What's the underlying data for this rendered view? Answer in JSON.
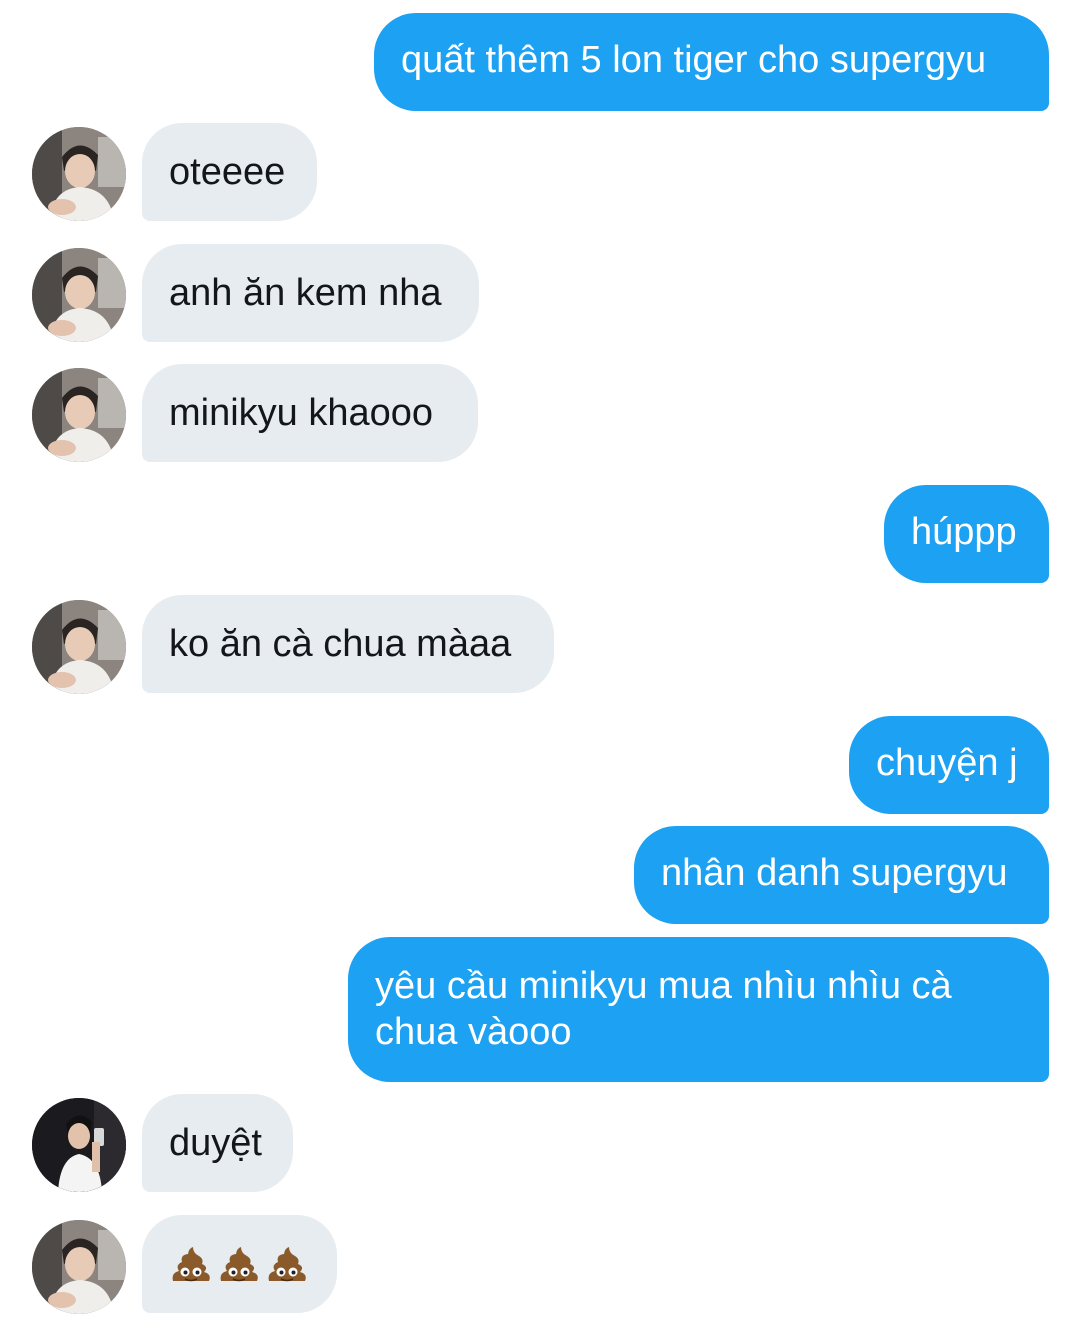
{
  "messages": [
    {
      "id": "m1",
      "side": "out",
      "text": "quất thêm 5 lon tiger cho supergyu"
    },
    {
      "id": "m2",
      "side": "in",
      "avatar": "user-a",
      "text": "oteeee"
    },
    {
      "id": "m3",
      "side": "in",
      "avatar": "user-a",
      "text": "anh ăn kem nha"
    },
    {
      "id": "m4",
      "side": "in",
      "avatar": "user-a",
      "text": "minikyu khaooo"
    },
    {
      "id": "m5",
      "side": "out",
      "text": "húppp"
    },
    {
      "id": "m6",
      "side": "in",
      "avatar": "user-a",
      "text": "ko ăn cà chua màaa"
    },
    {
      "id": "m7",
      "side": "out",
      "text": "chuyện j"
    },
    {
      "id": "m8",
      "side": "out",
      "text": "nhân danh supergyu"
    },
    {
      "id": "m9",
      "side": "out",
      "lines": [
        "yêu cầu minikyu mua nhìu nhìu cà",
        "chua vàooo"
      ]
    },
    {
      "id": "m10",
      "side": "in",
      "avatar": "user-b",
      "text": "duyệt"
    },
    {
      "id": "m11",
      "side": "in",
      "avatar": "user-a",
      "emoji": [
        "pile-of-poo-icon",
        "pile-of-poo-icon",
        "pile-of-poo-icon"
      ]
    }
  ],
  "colors": {
    "outgoing_bubble": "#1da1f2",
    "incoming_bubble": "#e6ecf0",
    "incoming_text": "#14171a",
    "outgoing_text": "#ffffff"
  }
}
